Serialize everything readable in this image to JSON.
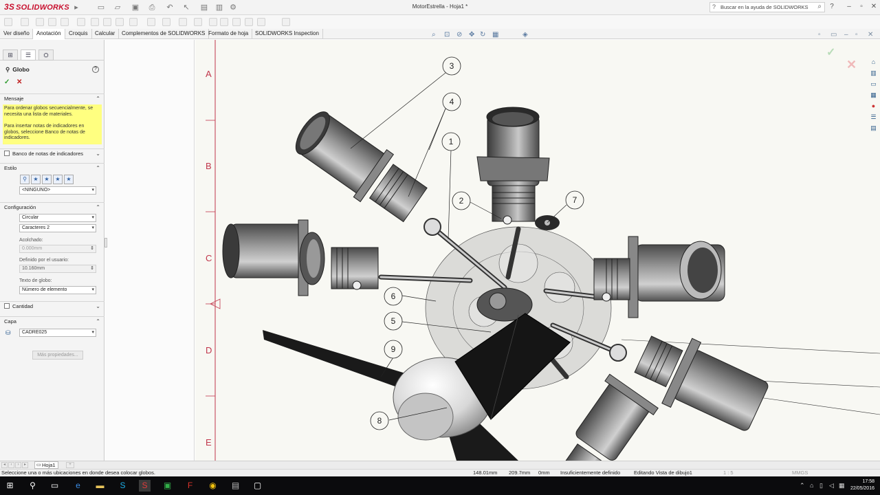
{
  "app": {
    "logo_text": "SOLIDWORKS",
    "logo_prefix": "3S",
    "document_title": "MotorEstrella - Hoja1 *",
    "help_search_placeholder": "Buscar en la ayuda de SOLIDWORKS",
    "brand_color": "#c8102e"
  },
  "tabs": [
    {
      "label": "Ver diseño",
      "active": false
    },
    {
      "label": "Anotación",
      "active": true
    },
    {
      "label": "Croquis",
      "active": false
    },
    {
      "label": "Calcular",
      "active": false
    },
    {
      "label": "Complementos de SOLIDWORKS",
      "active": false
    },
    {
      "label": "Formato de hoja",
      "active": false
    },
    {
      "label": "SOLIDWORKS Inspection",
      "active": false
    }
  ],
  "property_manager": {
    "title": "Globo",
    "message_header": "Mensaje",
    "message_lines": [
      "Para ordenar globos secuencialmente, se necesita una lista de materiales.",
      "Para insertar notas de indicadores en globos, seleccione Banco de notas de indicadores."
    ],
    "indicator_bank_label": "Banco de notas de indicadores",
    "style_header": "Estilo",
    "style_value": "<NINGUNO>",
    "config_header": "Configuración",
    "config_shape": "Circular",
    "config_size": "Caracteres 2",
    "padding_label": "Acolchado:",
    "padding_value": "0.000mm",
    "user_defined_label": "Definido por el usuario:",
    "user_defined_value": "10.160mm",
    "balloon_text_label": "Texto de globo:",
    "balloon_text_value": "Número de elemento",
    "quantity_label": "Cantidad",
    "layer_header": "Capa",
    "layer_value": "CADRE025",
    "more_properties_label": "Más propiedades..."
  },
  "sheet": {
    "zone_letters": [
      "A",
      "B",
      "C",
      "D",
      "E"
    ],
    "balloons": [
      "3",
      "4",
      "1",
      "2",
      "7",
      "6",
      "5",
      "9",
      "8"
    ]
  },
  "sheet_tab": "Hoja1",
  "status": {
    "prompt": "Seleccione una o más ubicaciones en donde desea colocar globos.",
    "x": "148.01mm",
    "y": "209.7mm",
    "z": "0mm",
    "definition": "Insuficientemente definido",
    "editing": "Editando Vista de dibujo1",
    "scale": "1 : 5",
    "units": "MMGS"
  },
  "clock": {
    "time": "17:58",
    "date": "22/05/2016"
  }
}
